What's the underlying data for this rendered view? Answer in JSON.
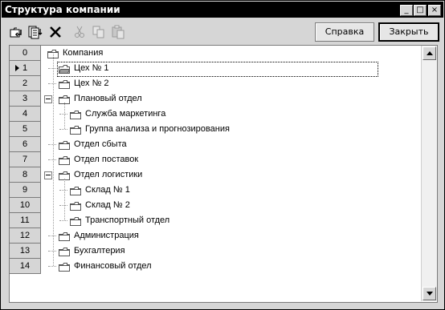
{
  "window": {
    "title": "Структура компании"
  },
  "titlebar_buttons": {
    "minimize": "_",
    "maximize": "□",
    "close": "×"
  },
  "toolbar": {
    "icons": [
      "add-row-icon",
      "add-subfolder-icon",
      "delete-icon",
      "cut-icon",
      "copy-icon",
      "paste-icon"
    ],
    "help_label": "Справка",
    "close_label": "Закрыть"
  },
  "tree": {
    "selected_index": 1,
    "rows": [
      {
        "num": "0",
        "label": "Компания"
      },
      {
        "num": "1",
        "label": "Цех № 1"
      },
      {
        "num": "2",
        "label": "Цех № 2"
      },
      {
        "num": "3",
        "label": "Плановый отдел"
      },
      {
        "num": "4",
        "label": "Служба маркетинга"
      },
      {
        "num": "5",
        "label": "Группа анализа и прогнозирования"
      },
      {
        "num": "6",
        "label": "Отдел сбыта"
      },
      {
        "num": "7",
        "label": "Отдел поставок"
      },
      {
        "num": "8",
        "label": "Отдел логистики"
      },
      {
        "num": "9",
        "label": "Склад № 1"
      },
      {
        "num": "10",
        "label": "Склад № 2"
      },
      {
        "num": "11",
        "label": "Транспортный отдел"
      },
      {
        "num": "12",
        "label": "Администрация"
      },
      {
        "num": "13",
        "label": "Бухгалтерия"
      },
      {
        "num": "14",
        "label": "Финансовый отдел"
      }
    ]
  }
}
